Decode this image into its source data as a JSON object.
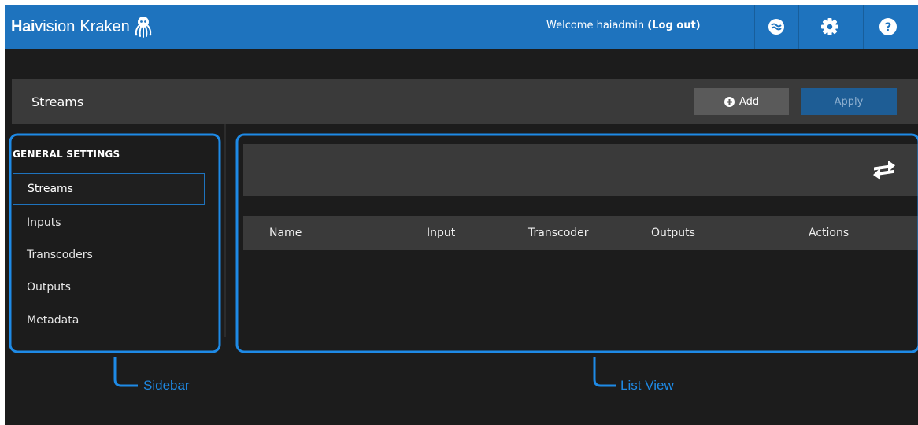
{
  "header": {
    "brand_bold": "Hai",
    "brand_regular": "vision",
    "brand_product": "Kraken",
    "welcome_text": "Welcome haiadmin",
    "logout_label": "(Log out)",
    "icons": [
      "haivision-status-icon",
      "gear-icon",
      "help-icon"
    ]
  },
  "titlebar": {
    "title": "Streams",
    "add_label": "Add",
    "apply_label": "Apply"
  },
  "sidebar": {
    "heading": "GENERAL SETTINGS",
    "items": [
      {
        "label": "Streams",
        "active": true
      },
      {
        "label": "Inputs",
        "active": false
      },
      {
        "label": "Transcoders",
        "active": false
      },
      {
        "label": "Outputs",
        "active": false
      },
      {
        "label": "Metadata",
        "active": false
      }
    ]
  },
  "list": {
    "columns": [
      "Name",
      "Input",
      "Transcoder",
      "Outputs",
      "Actions"
    ],
    "rows": []
  },
  "annotations": {
    "sidebar_label": "Sidebar",
    "list_label": "List View"
  },
  "colors": {
    "header_bg": "#1e73be",
    "app_bg": "#1c1c1c",
    "panel_bg": "#3a3a3a",
    "accent": "#1e8ae6",
    "apply_bg": "#1e5d95"
  }
}
